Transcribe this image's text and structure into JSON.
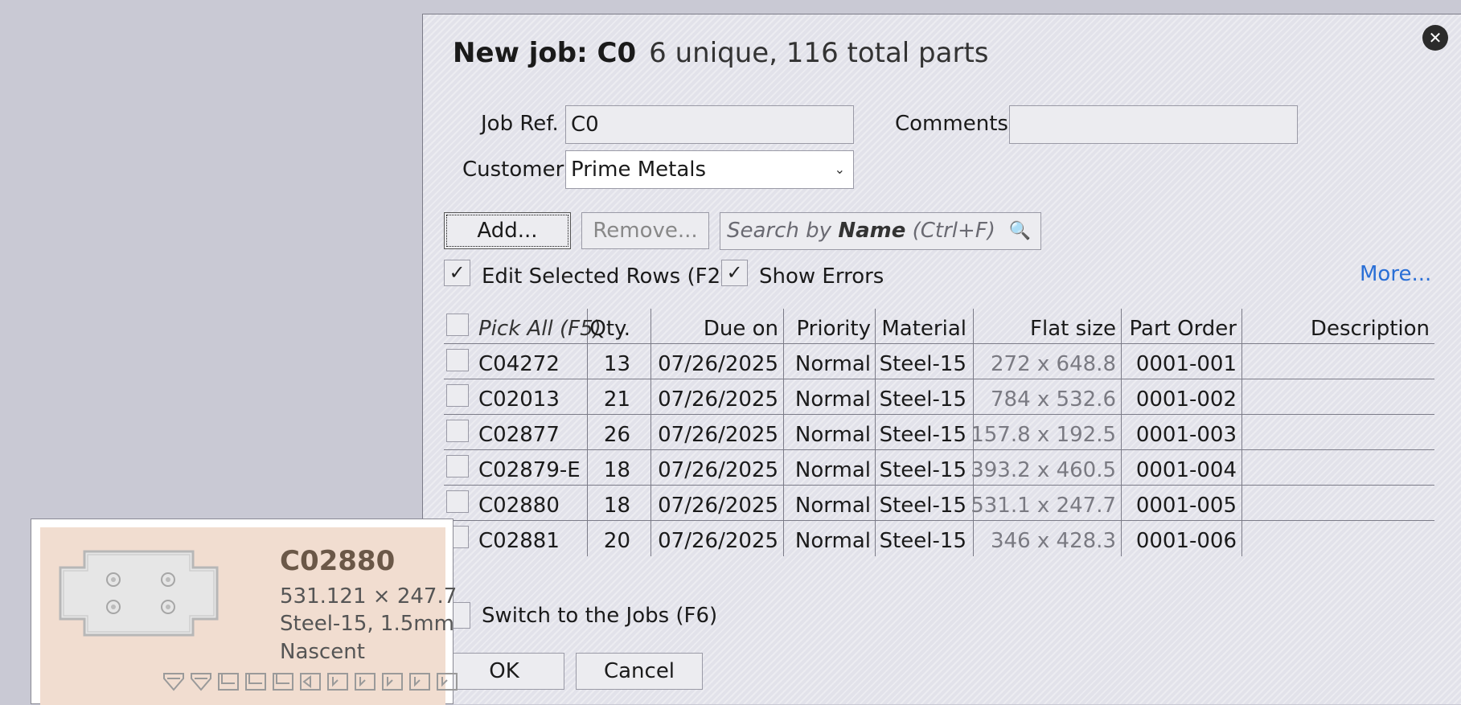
{
  "dialog": {
    "title_bold": "New job: C0",
    "title_sub": "6 unique, 116 total parts",
    "close_icon": "close-icon"
  },
  "form": {
    "job_ref_label": "Job Ref.",
    "job_ref_value": "C0",
    "comments_label": "Comments",
    "comments_value": "",
    "customer_label": "Customer",
    "customer_value": "Prime Metals"
  },
  "toolbar": {
    "add_label": "Add...",
    "remove_label": "Remove...",
    "search_prefix": "Search by ",
    "search_bold": "Name",
    "search_suffix": " (Ctrl+F)",
    "search_icon": "search-icon"
  },
  "options": {
    "edit_selected_label": "Edit Selected Rows (F2)",
    "edit_selected_checked": true,
    "show_errors_label": "Show Errors",
    "show_errors_checked": true,
    "more_label": "More..."
  },
  "table": {
    "headers": {
      "pick_all": "Pick All (F5)",
      "qty": "Qty.",
      "due_on": "Due on",
      "priority": "Priority",
      "material": "Material",
      "flat_size": "Flat size",
      "part_order": "Part Order",
      "description": "Description"
    },
    "rows": [
      {
        "name": "C04272",
        "qty": "13",
        "due": "07/26/2025",
        "priority": "Normal",
        "material": "Steel-15",
        "flat_size": "272 x 648.8",
        "part_order": "0001-001",
        "description": ""
      },
      {
        "name": "C02013",
        "qty": "21",
        "due": "07/26/2025",
        "priority": "Normal",
        "material": "Steel-15",
        "flat_size": "784 x 532.6",
        "part_order": "0001-002",
        "description": ""
      },
      {
        "name": "C02877",
        "qty": "26",
        "due": "07/26/2025",
        "priority": "Normal",
        "material": "Steel-15",
        "flat_size": "157.8 x 192.5",
        "part_order": "0001-003",
        "description": ""
      },
      {
        "name": "C02879-E",
        "qty": "18",
        "due": "07/26/2025",
        "priority": "Normal",
        "material": "Steel-15",
        "flat_size": "393.2 x 460.5",
        "part_order": "0001-004",
        "description": ""
      },
      {
        "name": "C02880",
        "qty": "18",
        "due": "07/26/2025",
        "priority": "Normal",
        "material": "Steel-15",
        "flat_size": "531.1 x 247.7",
        "part_order": "0001-005",
        "description": ""
      },
      {
        "name": "C02881",
        "qty": "20",
        "due": "07/26/2025",
        "priority": "Normal",
        "material": "Steel-15",
        "flat_size": "346 x 428.3",
        "part_order": "0001-006",
        "description": ""
      }
    ]
  },
  "footer": {
    "switch_label": "Switch to the Jobs (F6)",
    "ok_label": "OK",
    "cancel_label": "Cancel"
  },
  "preview": {
    "part_name": "C02880",
    "dimensions": "531.121 × 247.7",
    "material": "Steel-15, 1.5mm",
    "status": "Nascent"
  },
  "colors": {
    "background": "#c9c9d4",
    "dialog": "#e2e2ea",
    "link": "#2a6fd6",
    "preview_bg": "#f1ddd0"
  }
}
